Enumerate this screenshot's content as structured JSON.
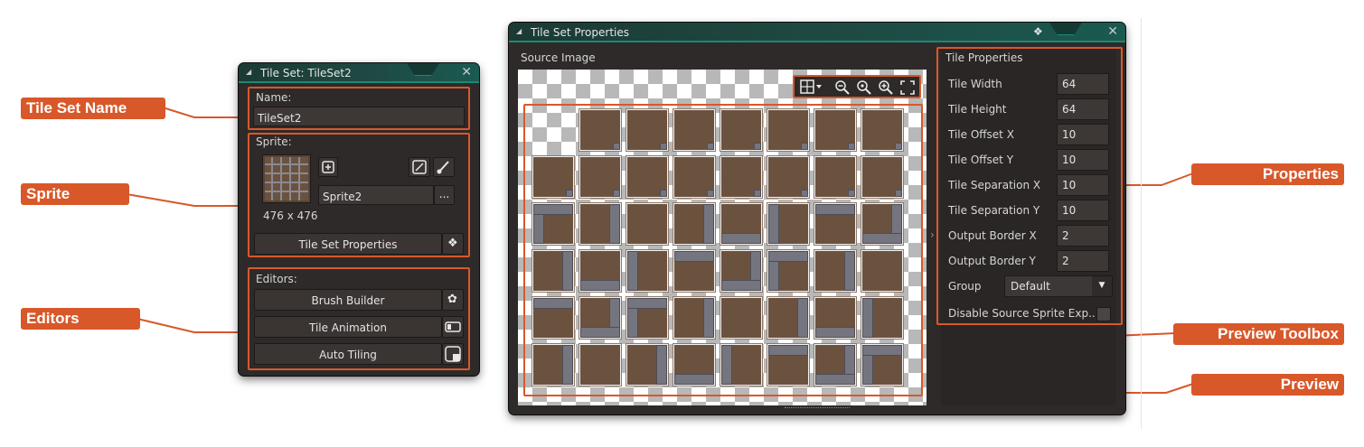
{
  "tileset_window": {
    "title": "Tile Set: TileSet2",
    "name_label": "Name:",
    "name_value": "TileSet2",
    "sprite_label": "Sprite:",
    "sprite_name": "Sprite2",
    "sprite_menu": "...",
    "sprite_size": "476 x 476",
    "tile_set_properties_button": "Tile Set Properties",
    "editors_label": "Editors:",
    "editors": [
      {
        "label": "Brush Builder",
        "icon": "brush-builder-icon"
      },
      {
        "label": "Tile Animation",
        "icon": "tile-animation-icon"
      },
      {
        "label": "Auto Tiling",
        "icon": "auto-tiling-icon"
      }
    ]
  },
  "properties_window": {
    "title": "Tile Set Properties",
    "source_image_label": "Source Image",
    "tile_properties_label": "Tile Properties",
    "properties": [
      {
        "label": "Tile Width",
        "value": "64"
      },
      {
        "label": "Tile Height",
        "value": "64"
      },
      {
        "label": "Tile Offset X",
        "value": "10"
      },
      {
        "label": "Tile Offset Y",
        "value": "10"
      },
      {
        "label": "Tile Separation X",
        "value": "10"
      },
      {
        "label": "Tile Separation Y",
        "value": "10"
      },
      {
        "label": "Output Border X",
        "value": "2"
      },
      {
        "label": "Output Border Y",
        "value": "2"
      }
    ],
    "group_label": "Group",
    "group_value": "Default",
    "disable_label": "Disable Source Sprite Exp...",
    "toolbox_icons": [
      "grid-icon",
      "zoom-out-icon",
      "zoom-reset-icon",
      "zoom-in-icon",
      "fit-screen-icon"
    ]
  },
  "callouts": {
    "tile_set_name": "Tile Set Name",
    "sprite": "Sprite",
    "editors": "Editors",
    "properties": "Properties",
    "preview_toolbox": "Preview Toolbox",
    "preview": "Preview"
  },
  "colors": {
    "accent": "#d8582a",
    "panel": "#2e2a29",
    "title_bar": "#1e4a43",
    "tile_dirt": "#6b523f",
    "tile_wall": "#75757f"
  }
}
